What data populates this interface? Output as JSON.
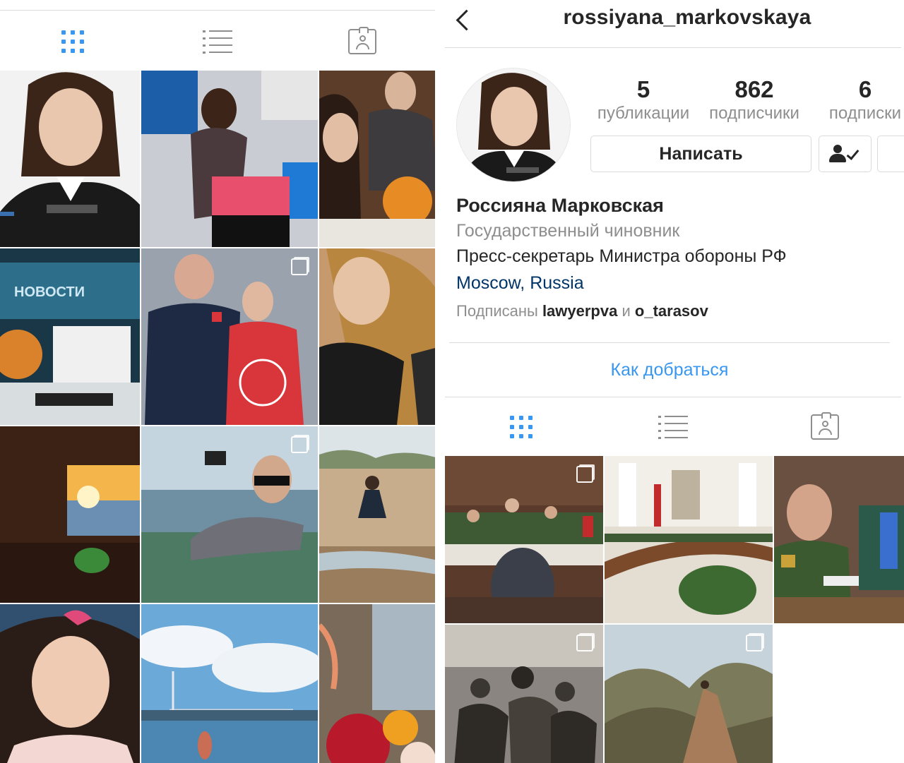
{
  "left": {
    "tabs": [
      {
        "name": "grid",
        "active": true
      },
      {
        "name": "list",
        "active": false
      },
      {
        "name": "tagged",
        "active": false
      }
    ],
    "tiles": [
      {
        "desc": "portrait uniform",
        "multi": false
      },
      {
        "desc": "studio flowers",
        "multi": false
      },
      {
        "desc": "meeting flowers",
        "multi": false
      },
      {
        "desc": "news desk",
        "multi": false
      },
      {
        "desc": "hockey jersey",
        "multi": true
      },
      {
        "desc": "selfie",
        "multi": false
      },
      {
        "desc": "sunset window",
        "multi": false
      },
      {
        "desc": "sea glass beach",
        "multi": true
      },
      {
        "desc": "beach jump",
        "multi": false
      },
      {
        "desc": "child portrait",
        "multi": false
      },
      {
        "desc": "bridge sea",
        "multi": false
      },
      {
        "desc": "flowers window",
        "multi": false
      }
    ]
  },
  "header": {
    "username": "rossiyana_markovskaya"
  },
  "stats": {
    "posts": {
      "value": "5",
      "label": "публикации"
    },
    "followers": {
      "value": "862",
      "label": "подписчики"
    },
    "following": {
      "value": "6",
      "label": "подписки"
    }
  },
  "actions": {
    "message_label": "Написать"
  },
  "bio": {
    "full_name": "Россияна Марковская",
    "category": "Государственный чиновник",
    "text": "Пресс-секретарь Министра обороны РФ",
    "location": "Moscow, Russia",
    "followed_prefix": "Подписаны",
    "followed_user1": "lawyerpva",
    "followed_and": "и",
    "followed_user2": "o_tarasov"
  },
  "directions_label": "Как добраться",
  "right": {
    "tabs": [
      {
        "name": "grid",
        "active": true
      },
      {
        "name": "list",
        "active": false
      },
      {
        "name": "tagged",
        "active": false
      }
    ],
    "tiles": [
      {
        "desc": "ministry meeting",
        "multi": true
      },
      {
        "desc": "conference hall",
        "multi": false
      },
      {
        "desc": "general portrait",
        "multi": false
      },
      {
        "desc": "archive photo",
        "multi": true
      },
      {
        "desc": "mountain",
        "multi": true
      }
    ]
  },
  "colors": {
    "accent": "#3897f0",
    "text": "#262626",
    "muted": "#8e8e8e",
    "divider": "#dbdbdb",
    "location": "#003569"
  }
}
